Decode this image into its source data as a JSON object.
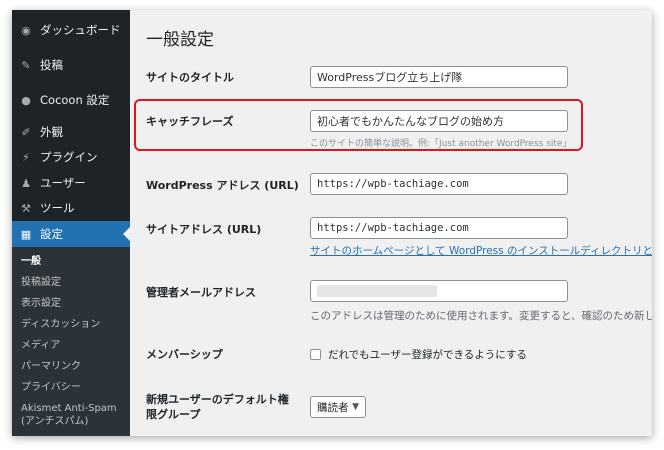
{
  "sidebar": {
    "items": [
      {
        "label": "ダッシュボード",
        "icon": "dashboard-icon"
      },
      {
        "label": "投稿",
        "icon": "pin-icon"
      },
      {
        "label": "Cocoon 設定",
        "icon": "circle-icon"
      },
      {
        "label": "外観",
        "icon": "brush-icon"
      },
      {
        "label": "プラグイン",
        "icon": "plug-icon"
      },
      {
        "label": "ユーザー",
        "icon": "user-icon"
      },
      {
        "label": "ツール",
        "icon": "wrench-icon"
      },
      {
        "label": "設定",
        "icon": "settings-icon"
      }
    ],
    "submenu": [
      "一般",
      "投稿設定",
      "表示設定",
      "ディスカッション",
      "メディア",
      "パーマリンク",
      "プライバシー",
      "Akismet Anti-Spam (アンチスパム)"
    ]
  },
  "page": {
    "title": "一般設定",
    "site_title_label": "サイトのタイトル",
    "site_title_value": "WordPressブログ立ち上げ隊",
    "tagline_label": "キャッチフレーズ",
    "tagline_value": "初心者でもかんたんなブログの始め方",
    "tagline_desc": "このサイトの簡単な説明。例:「Just another WordPress site」",
    "wp_address_label": "WordPress アドレス (URL)",
    "wp_address_value": "https://wpb-tachiage.com",
    "site_address_label": "サイトアドレス (URL)",
    "site_address_value": "https://wpb-tachiage.com",
    "site_address_link": "サイトのホームページとして WordPress のインストールディレクトリとは",
    "admin_email_label": "管理者メールアドレス",
    "admin_email_desc": "このアドレスは管理のために使用されます。変更すると、確認のため新し",
    "membership_label": "メンバーシップ",
    "membership_checkbox": "だれでもユーザー登録ができるようにする",
    "default_role_label": "新規ユーザーのデフォルト権限グループ",
    "default_role_value": "購読者"
  },
  "colors": {
    "sidebar_bg": "#1d2327",
    "active": "#2271b1",
    "highlight": "#e0161d"
  }
}
